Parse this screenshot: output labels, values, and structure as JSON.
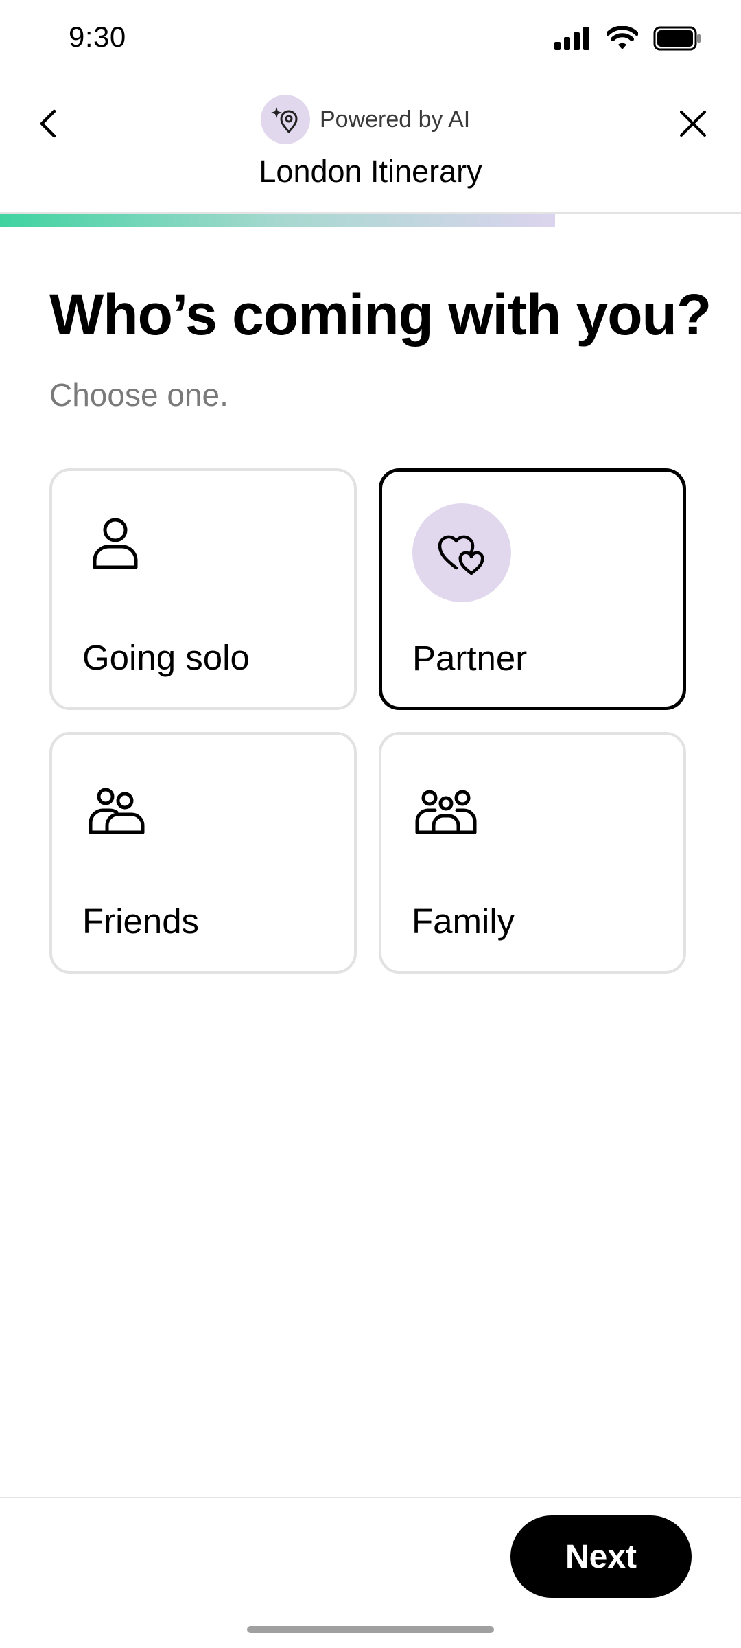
{
  "status_bar": {
    "time": "9:30"
  },
  "nav": {
    "powered_label": "Powered by AI",
    "title": "London Itinerary",
    "progress": 0.75
  },
  "main": {
    "heading": "Who’s coming with you?",
    "subheading": "Choose one.",
    "options": [
      {
        "label": "Going solo",
        "icon": "person-icon",
        "selected": false
      },
      {
        "label": "Partner",
        "icon": "hearts-icon",
        "selected": true
      },
      {
        "label": "Friends",
        "icon": "two-people-icon",
        "selected": false
      },
      {
        "label": "Family",
        "icon": "family-icon",
        "selected": false
      }
    ]
  },
  "footer": {
    "next_label": "Next"
  },
  "colors": {
    "accent_badge": "#e2d8ee",
    "progress_start": "#3fd3a0",
    "progress_end": "#dcd4ee",
    "button": "#000000"
  }
}
